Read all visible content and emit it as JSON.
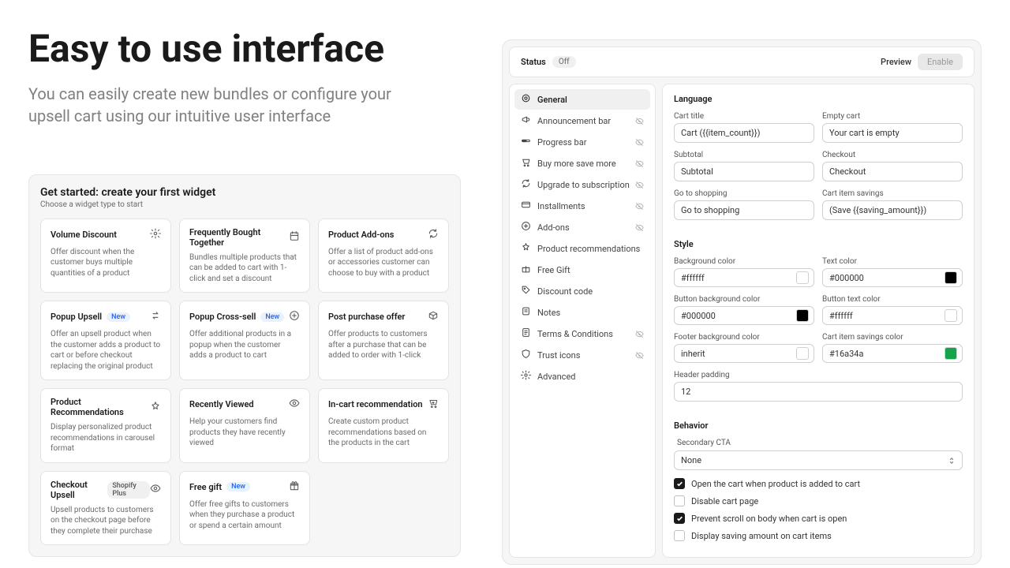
{
  "hero": {
    "title": "Easy to use interface",
    "subtitle": "You can easily create new bundles or configure your upsell cart using our intuitive user interface"
  },
  "getStarted": {
    "title": "Get started: create your first widget",
    "subtitle": "Choose a widget type to start"
  },
  "widgets": [
    {
      "title": "Volume Discount",
      "desc": "Offer discount when the customer buys multiple quantities of a product",
      "icon": "gear"
    },
    {
      "title": "Frequently Bought Together",
      "desc": "Bundles multiple products that can be added to cart with 1-click and set a discount",
      "icon": "calendar"
    },
    {
      "title": "Product Add-ons",
      "desc": "Offer a list of product add-ons or accessories customer can choose to buy with a product",
      "icon": "refresh"
    },
    {
      "title": "Popup Upsell",
      "badge": "New",
      "desc": "Offer an upsell product when the customer adds a product to cart or before checkout replacing the original product",
      "icon": "swap"
    },
    {
      "title": "Popup Cross-sell",
      "badge": "New",
      "desc": "Offer additional products in a popup when the customer adds a product to cart",
      "icon": "plus-circle"
    },
    {
      "title": "Post purchase offer",
      "desc": "Offer products to customers after a purchase that can be added to order with 1-click",
      "icon": "box"
    },
    {
      "title": "Product Recommendations",
      "desc": "Display personalized product recommendations in carousel format",
      "icon": "star-cross"
    },
    {
      "title": "Recently Viewed",
      "desc": "Help your customers find products they have recently viewed",
      "icon": "eye"
    },
    {
      "title": "In-cart recommendation",
      "desc": "Create custom product recommendations based on the products in the cart",
      "icon": "cart-plus"
    },
    {
      "title": "Checkout Upsell",
      "badge": "Shopify Plus",
      "badgeType": "plus",
      "desc": "Upsell products to customers on the checkout page before they complete their purchase",
      "icon": "eye"
    },
    {
      "title": "Free gift",
      "badge": "New",
      "desc": "Offer free gifts to customers when they purchase a product or spend a certain amount",
      "icon": "gift"
    }
  ],
  "status": {
    "label": "Status",
    "value": "Off",
    "preview": "Preview",
    "enable": "Enable"
  },
  "sidebar": [
    {
      "label": "General",
      "icon": "target",
      "active": true
    },
    {
      "label": "Announcement bar",
      "icon": "megaphone",
      "hidden": true
    },
    {
      "label": "Progress bar",
      "icon": "progress",
      "hidden": true
    },
    {
      "label": "Buy more save more",
      "icon": "cart",
      "hidden": true
    },
    {
      "label": "Upgrade to subscription",
      "icon": "refresh",
      "hidden": true
    },
    {
      "label": "Installments",
      "icon": "card",
      "hidden": true
    },
    {
      "label": "Add-ons",
      "icon": "plus",
      "hidden": true
    },
    {
      "label": "Product recommendations",
      "icon": "star"
    },
    {
      "label": "Free Gift",
      "icon": "gift"
    },
    {
      "label": "Discount code",
      "icon": "tag"
    },
    {
      "label": "Notes",
      "icon": "note"
    },
    {
      "label": "Terms & Conditions",
      "icon": "doc",
      "hidden": true
    },
    {
      "label": "Trust icons",
      "icon": "shield",
      "hidden": true
    },
    {
      "label": "Advanced",
      "icon": "gear"
    }
  ],
  "language": {
    "heading": "Language",
    "cartTitle": {
      "label": "Cart title",
      "value": "Cart ({{item_count}})"
    },
    "emptyCart": {
      "label": "Empty cart",
      "value": "Your cart is empty"
    },
    "subtotal": {
      "label": "Subtotal",
      "value": "Subtotal"
    },
    "checkout": {
      "label": "Checkout",
      "value": "Checkout"
    },
    "goShopping": {
      "label": "Go to shopping",
      "value": "Go to shopping"
    },
    "savings": {
      "label": "Cart item savings",
      "value": "(Save {{saving_amount}})"
    }
  },
  "style": {
    "heading": "Style",
    "bgColor": {
      "label": "Background color",
      "value": "#ffffff"
    },
    "textColor": {
      "label": "Text color",
      "value": "#000000"
    },
    "btnBg": {
      "label": "Button background color",
      "value": "#000000"
    },
    "btnText": {
      "label": "Button text color",
      "value": "#ffffff"
    },
    "footerBg": {
      "label": "Footer background color",
      "value": "inherit"
    },
    "savingsColor": {
      "label": "Cart item savings color",
      "value": "#16a34a"
    },
    "headerPadding": {
      "label": "Header padding",
      "value": "12"
    }
  },
  "behavior": {
    "heading": "Behavior",
    "secondaryCta": {
      "label": "Secondary CTA",
      "value": "None"
    },
    "openOnAdd": {
      "label": "Open the cart when product is added to cart",
      "checked": true
    },
    "disablePage": {
      "label": "Disable cart page",
      "checked": false
    },
    "preventScroll": {
      "label": "Prevent scroll on body when cart is open",
      "checked": true
    },
    "displaySaving": {
      "label": "Display saving amount on cart items",
      "checked": false
    }
  }
}
